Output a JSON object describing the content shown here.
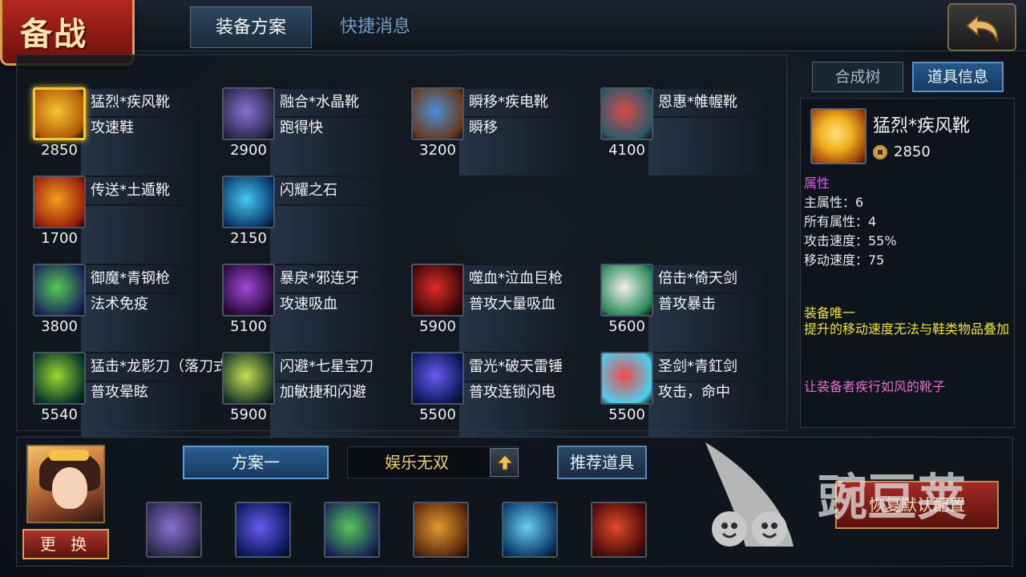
{
  "header": {
    "title": "备战",
    "tabs": [
      {
        "label": "装备方案",
        "active": true
      },
      {
        "label": "快捷消息",
        "active": false
      }
    ],
    "back_icon": "back-arrow-icon"
  },
  "items": [
    {
      "name": "猛烈*疾风靴",
      "desc": "攻速鞋",
      "price": "2850",
      "icon": "golden-boot-icon",
      "colors": [
        "#f6c531",
        "#b35a08"
      ],
      "selected": true
    },
    {
      "name": "融合*水晶靴",
      "desc": "跑得快",
      "price": "2900",
      "icon": "crystal-boot-icon",
      "colors": [
        "#8a6fd6",
        "#2a2a4a"
      ]
    },
    {
      "name": "瞬移*疾电靴",
      "desc": "瞬移",
      "price": "3200",
      "icon": "lightning-boot-icon",
      "colors": [
        "#4b8fd6",
        "#6a3a1e"
      ]
    },
    {
      "name": "恩惠*帷幄靴",
      "desc": "",
      "price": "4100",
      "icon": "red-boot-icon",
      "colors": [
        "#d84a4a",
        "#2a5a6a"
      ]
    },
    {
      "name": "传送*土遁靴",
      "desc": "",
      "price": "1700",
      "icon": "fire-boot-icon",
      "colors": [
        "#f0a020",
        "#a0200a"
      ]
    },
    {
      "name": "闪耀之石",
      "desc": "",
      "price": "2150",
      "icon": "blue-gem-icon",
      "colors": [
        "#46c8f0",
        "#0a3a70"
      ]
    },
    {
      "name": "御魔*青钢枪",
      "desc": "法术免疫",
      "price": "3800",
      "icon": "green-spear-icon",
      "colors": [
        "#56c85a",
        "#1a2a5a"
      ]
    },
    {
      "name": "暴戾*邪连牙",
      "desc": "攻速吸血",
      "price": "5100",
      "icon": "purple-claw-icon",
      "colors": [
        "#a248d8",
        "#2a0a3a"
      ]
    },
    {
      "name": "噬血*泣血巨枪",
      "desc": "普攻大量吸血",
      "price": "5900",
      "icon": "blood-spear-icon",
      "colors": [
        "#e02a2a",
        "#3a0808"
      ]
    },
    {
      "name": "倍击*倚天剑",
      "desc": "普攻暴击",
      "price": "5600",
      "icon": "sky-sword-icon",
      "colors": [
        "#f0f0f0",
        "#2a8a5a"
      ]
    },
    {
      "name": "猛击*龙影刀（落刀式",
      "desc": "普攻晕眩",
      "price": "5540",
      "icon": "dragon-blade-icon",
      "colors": [
        "#9ad830",
        "#0a3a2a"
      ]
    },
    {
      "name": "闪避*七星宝刀",
      "desc": "加敏捷和闪避",
      "price": "5900",
      "icon": "star-dagger-icon",
      "colors": [
        "#c8e050",
        "#1a3a2a"
      ]
    },
    {
      "name": "雷光*破天雷锤",
      "desc": "普攻连锁闪电",
      "price": "5500",
      "icon": "thunder-hammer-icon",
      "colors": [
        "#6a5af0",
        "#0a1a5a"
      ]
    },
    {
      "name": "圣剑*青釭剑",
      "desc": "攻击，命中",
      "price": "5500",
      "icon": "rainbow-sword-icon",
      "colors": [
        "#f04a4a",
        "#4ad0f0"
      ]
    }
  ],
  "info_panel": {
    "tab_tree": "合成树",
    "tab_info": "道具信息",
    "name": "猛烈*疾风靴",
    "price": "2850",
    "attr_header": "属性",
    "attrs": [
      "主属性：6",
      "所有属性：4",
      "攻击速度：55%",
      "移动速度：75"
    ],
    "unique_title": "装备唯一",
    "unique_desc": "提升的移动速度无法与鞋类物品叠加",
    "flavor": "让装备者疾行如风的靴子"
  },
  "bottom": {
    "change_label": "更 换",
    "plan_label": "方案一",
    "plan_name": "娱乐无双",
    "recommend_label": "推荐道具",
    "restore_label": "恢复默认配置",
    "slots": [
      {
        "icon": "crystal-boot-icon",
        "colors": [
          "#8a6fd6",
          "#2a2a4a"
        ]
      },
      {
        "icon": "thunder-hammer-icon",
        "colors": [
          "#6a5af0",
          "#0a1a5a"
        ]
      },
      {
        "icon": "green-spear-icon",
        "colors": [
          "#56c85a",
          "#1a2a5a"
        ]
      },
      {
        "icon": "ram-skull-icon",
        "colors": [
          "#e09a30",
          "#5a2a0a"
        ]
      },
      {
        "icon": "ice-spear-icon",
        "colors": [
          "#6ad0f0",
          "#0a3a6a"
        ]
      },
      {
        "icon": "dragon-armor-icon",
        "colors": [
          "#e04a2a",
          "#4a0a0a"
        ]
      }
    ]
  },
  "watermark": {
    "text": "豌豆荚"
  }
}
